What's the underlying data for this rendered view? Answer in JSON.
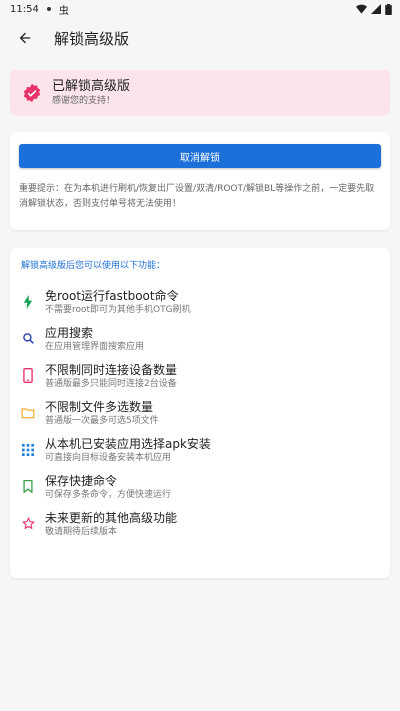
{
  "status_bar": {
    "time": "11:54",
    "debug_glyph": "虫"
  },
  "app_bar": {
    "title": "解锁高级版"
  },
  "unlocked_card": {
    "title": "已解锁高级版",
    "subtitle": "感谢您的支持！"
  },
  "cancel_card": {
    "button_label": "取消解锁",
    "notice": "重要提示：在为本机进行刷机/恢复出厂设置/双清/ROOT/解锁BL等操作之前，一定要先取消解锁状态，否则支付单号将无法使用！"
  },
  "features": {
    "header": "解锁高级版后您可以使用以下功能：",
    "items": [
      {
        "icon": "flash-icon",
        "color": "#12a150",
        "title": "免root运行fastboot命令",
        "desc": "不需要root即可为其他手机OTG刷机"
      },
      {
        "icon": "search-icon",
        "color": "#2a3fb8",
        "title": "应用搜索",
        "desc": "在应用管理界面搜索应用"
      },
      {
        "icon": "phone-icon",
        "color": "#e8336b",
        "title": "不限制同时连接设备数量",
        "desc": "普通版最多只能同时连接2台设备"
      },
      {
        "icon": "folder-icon",
        "color": "#f5a623",
        "title": "不限制文件多选数量",
        "desc": "普通版一次最多可选5项文件"
      },
      {
        "icon": "apps-grid-icon",
        "color": "#1d7fd9",
        "title": "从本机已安装应用选择apk安装",
        "desc": "可直接向目标设备安装本机应用"
      },
      {
        "icon": "bookmark-icon",
        "color": "#3aa14a",
        "title": "保存快捷命令",
        "desc": "可保存多条命令，方便快速运行"
      },
      {
        "icon": "star-icon",
        "color": "#e8336b",
        "title": "未来更新的其他高级功能",
        "desc": "敬请期待后续版本"
      }
    ]
  },
  "colors": {
    "accent": "#1d6fd9",
    "unlocked_bg": "#fbe5ea",
    "verified": "#e8336b"
  }
}
